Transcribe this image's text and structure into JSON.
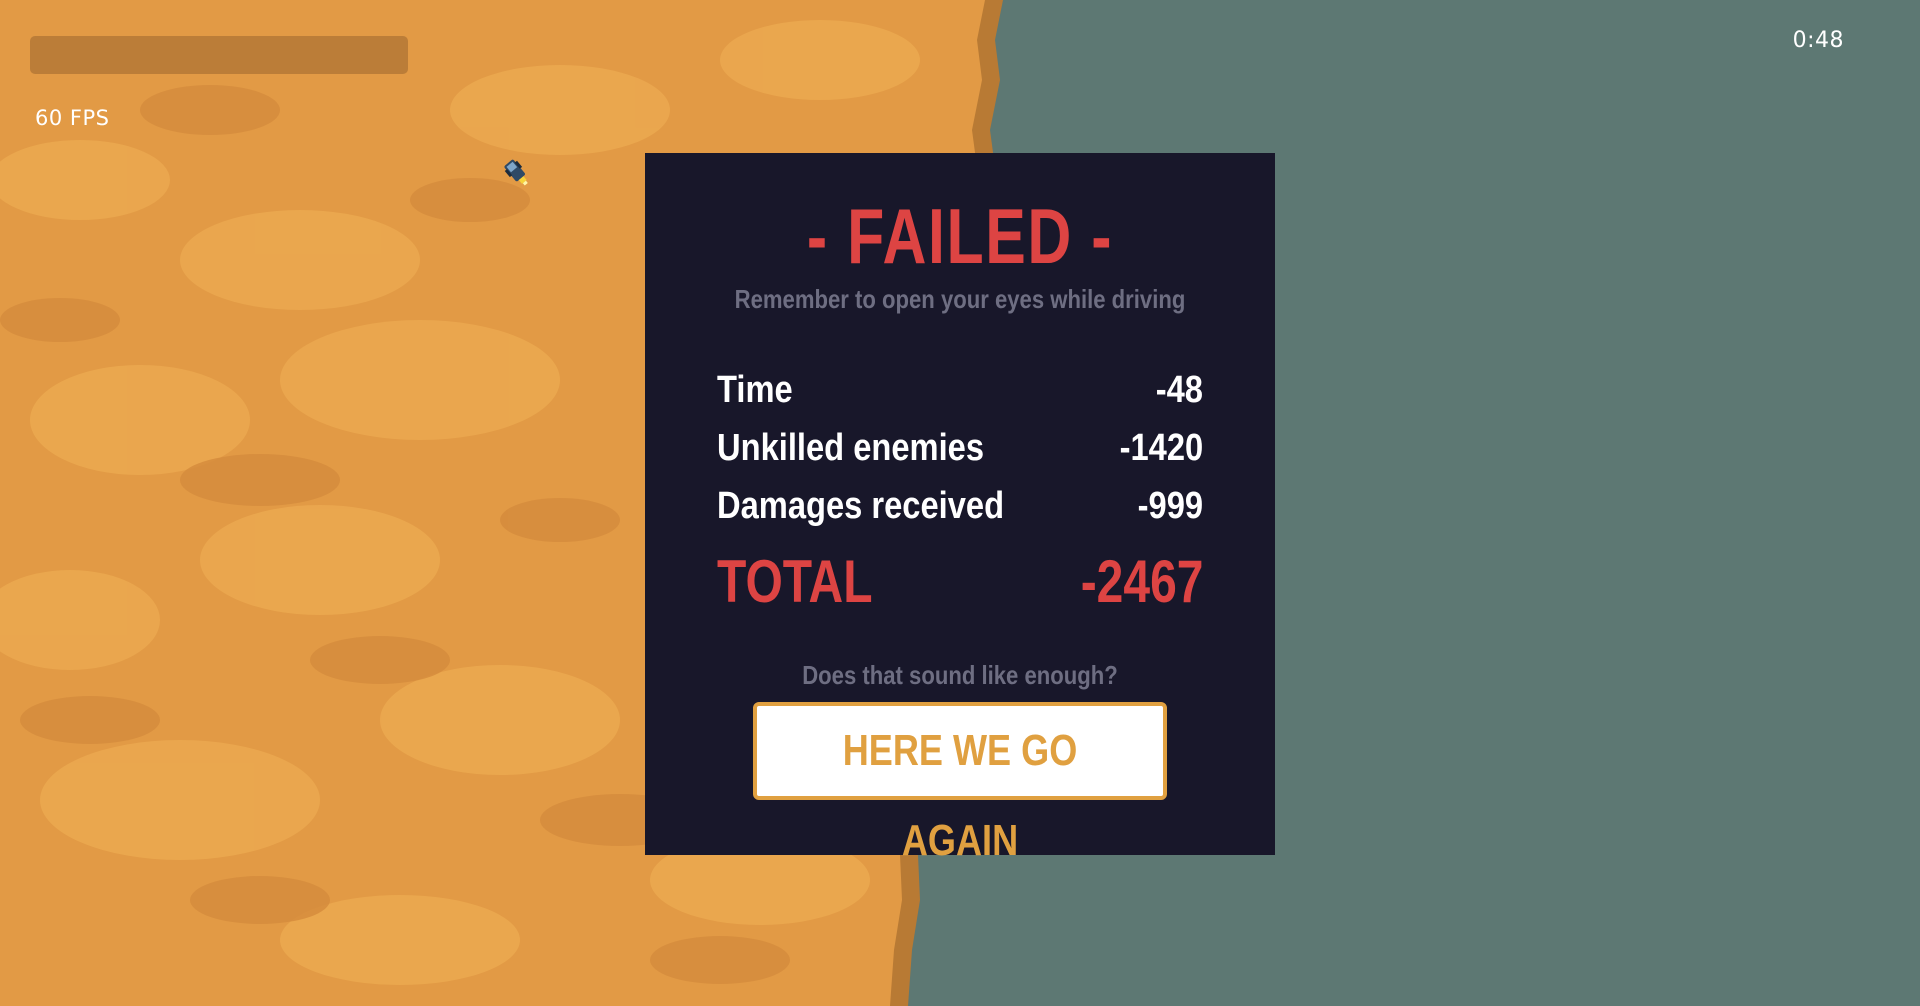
{
  "hud": {
    "fps_label": "60 FPS",
    "timer": "0:48",
    "health_bar_level": 0.0
  },
  "colors": {
    "sand": "#e29a45",
    "sand_light": "#eba84f",
    "sand_dark": "#d58b3c",
    "shore": "#b87a34",
    "water": "#5d7873",
    "panel_bg": "#18172a",
    "title_red": "#dd4443",
    "muted_text": "#6e6e82",
    "button_accent": "#e0a040"
  },
  "result_panel": {
    "title": "- FAILED -",
    "subtitle": "Remember to open your eyes while driving",
    "stats": [
      {
        "label": "Time",
        "value": "-48"
      },
      {
        "label": "Unkilled enemies",
        "value": "-1420"
      },
      {
        "label": "Damages received",
        "value": "-999"
      }
    ],
    "total": {
      "label": "TOTAL",
      "value": "-2467"
    },
    "question": "Does that sound like enough?",
    "retry_button_label": "HERE WE GO AGAIN"
  },
  "player": {
    "icon": "player-vehicle-icon"
  }
}
